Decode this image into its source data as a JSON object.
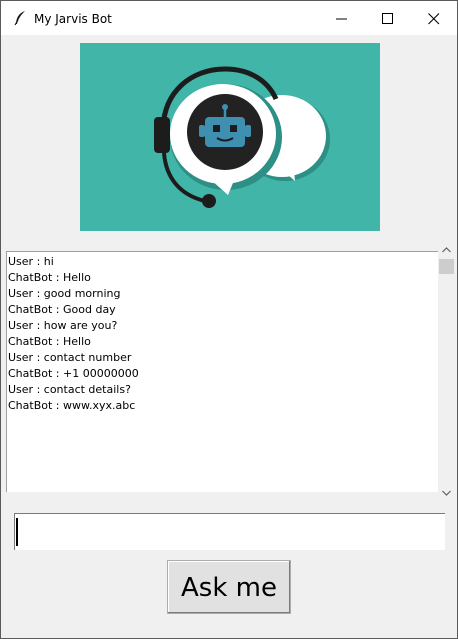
{
  "window": {
    "title": "My Jarvis Bot",
    "icon": "feather-icon"
  },
  "titlebar_controls": [
    "minimize-icon",
    "maximize-icon",
    "close-icon"
  ],
  "logo": {
    "icon": "headset-chatbot-icon",
    "background_color": "#40b5a8"
  },
  "chat": {
    "messages": [
      "User : hi",
      "ChatBot : Hello",
      "User : good morning",
      "ChatBot : Good day",
      "User : how are you?",
      "ChatBot : Hello",
      "User : contact number",
      "ChatBot : +1 00000000",
      "User : contact details?",
      "ChatBot : www.xyx.abc"
    ]
  },
  "input": {
    "value": ""
  },
  "ask_button": {
    "label": "Ask me"
  }
}
